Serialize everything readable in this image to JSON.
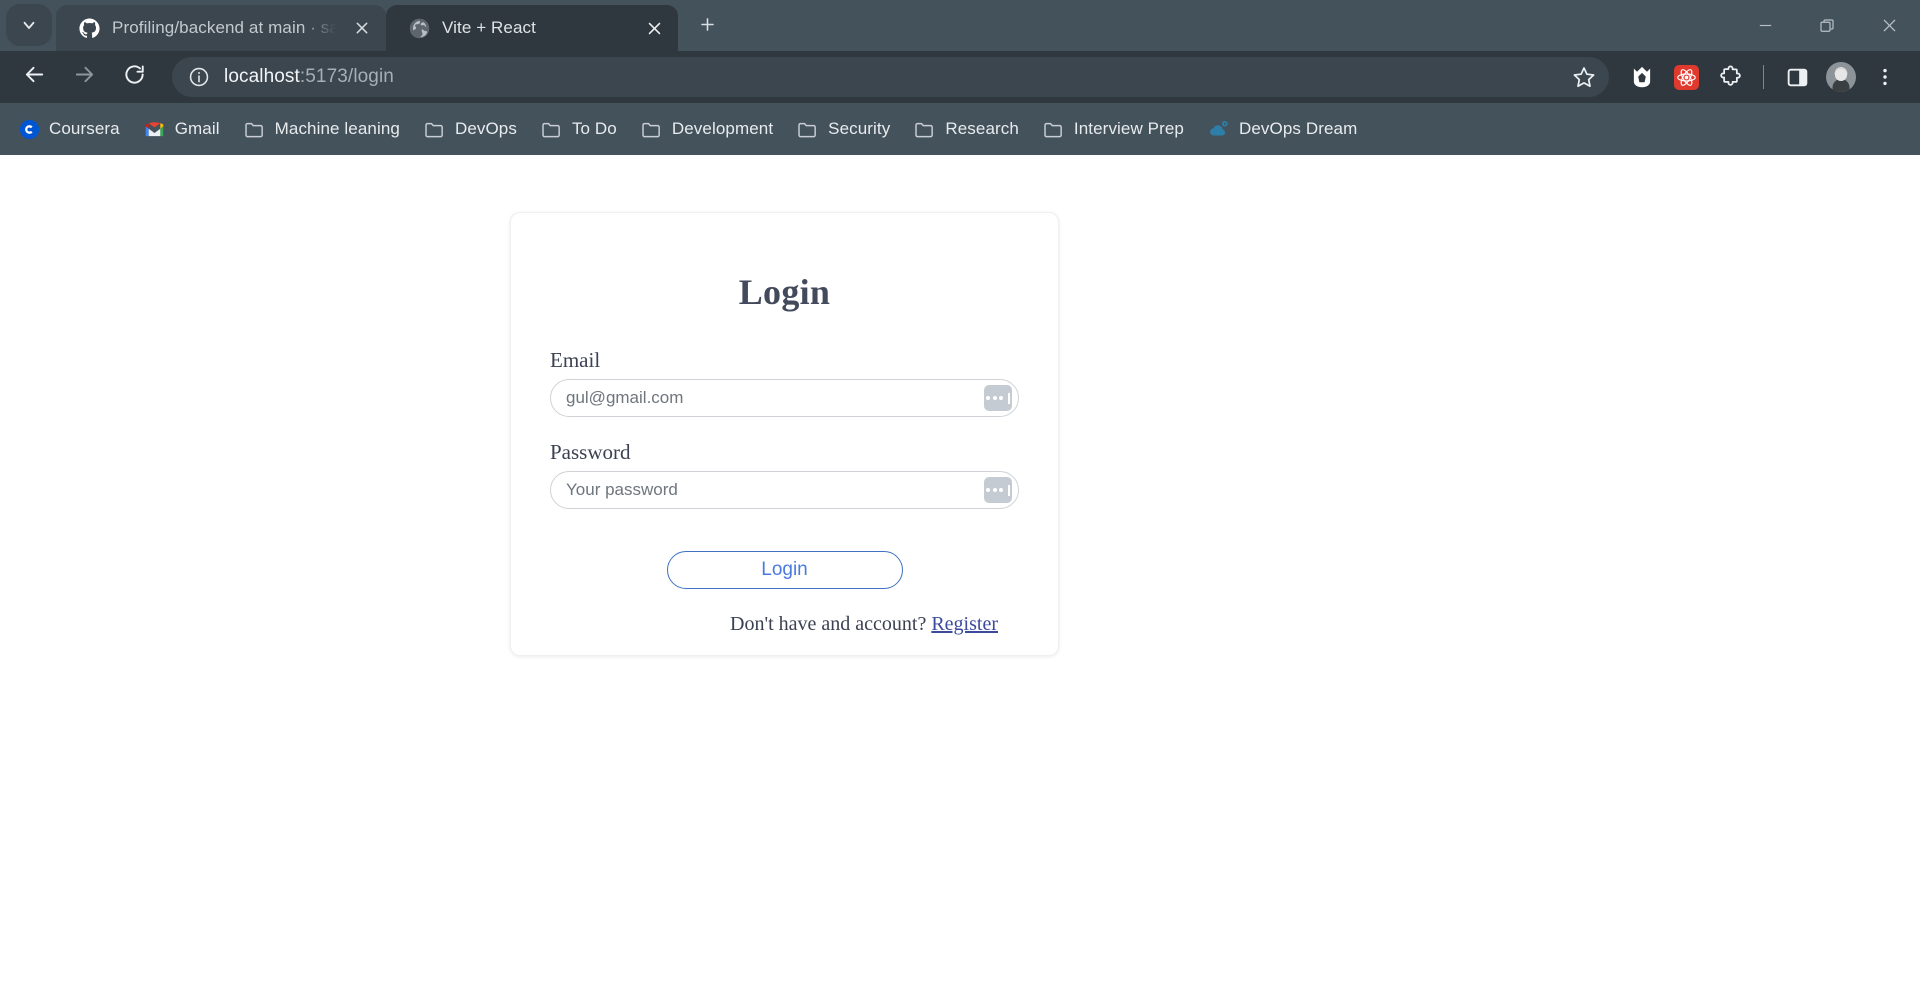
{
  "window": {
    "controls": [
      {
        "name": "minimize",
        "label": "Minimize"
      },
      {
        "name": "restore",
        "label": "Restore"
      },
      {
        "name": "close",
        "label": "Close"
      }
    ]
  },
  "tabstrip": {
    "tab_search_icon": "chevron-down-icon",
    "new_tab_label": "+",
    "tabs": [
      {
        "title": "Profiling/backend at main · sam",
        "favicon": "github-icon",
        "active": false
      },
      {
        "title": "Vite + React",
        "favicon": "globe-icon",
        "active": true
      }
    ]
  },
  "toolbar": {
    "back_icon": "arrow-left-icon",
    "forward_icon": "arrow-right-icon",
    "reload_icon": "reload-icon",
    "site_info_icon": "info-circle-icon",
    "url_host": "localhost",
    "url_rest": ":5173/login",
    "url_full": "localhost:5173/login",
    "bookmark_icon": "star-icon",
    "extensions": [
      {
        "name": "malwarebytes-extension",
        "label": "Malwarebytes",
        "color": "#ffffff"
      },
      {
        "name": "react-devtools-extension",
        "label": "React Developer Tools",
        "color": "#e03a2f"
      },
      {
        "name": "extensions-puzzle",
        "label": "Extensions",
        "color": "#ffffff"
      }
    ],
    "side_panel_icon": "side-panel-icon",
    "profile_label": "Profile",
    "menu_icon": "three-dot-menu-icon"
  },
  "bookmarks": [
    {
      "label": "Coursera",
      "icon": "coursera-icon"
    },
    {
      "label": "Gmail",
      "icon": "gmail-icon"
    },
    {
      "label": "Machine leaning",
      "icon": "folder-icon"
    },
    {
      "label": "DevOps",
      "icon": "folder-icon"
    },
    {
      "label": "To Do",
      "icon": "folder-icon"
    },
    {
      "label": "Development",
      "icon": "folder-icon"
    },
    {
      "label": "Security",
      "icon": "folder-icon"
    },
    {
      "label": "Research",
      "icon": "folder-icon"
    },
    {
      "label": "Interview Prep",
      "icon": "folder-icon"
    },
    {
      "label": "DevOps Dream",
      "icon": "cloud-gear-icon"
    }
  ],
  "page": {
    "title": "Login",
    "email": {
      "label": "Email",
      "value": "",
      "placeholder": "gul@gmail.com",
      "autofill_icon": "password-key-icon"
    },
    "password": {
      "label": "Password",
      "value": "",
      "placeholder": "Your password",
      "autofill_icon": "password-key-icon"
    },
    "submit_label": "Login",
    "register_prompt": "Don't have and account?",
    "register_link": "Register"
  },
  "colors": {
    "chrome_tabstrip": "#44525c",
    "chrome_toolbar": "#2f383f",
    "chrome_bookmarkbar": "#44525c",
    "accent_blue": "#4a7ae0",
    "link_blue": "#3b4a9c",
    "heading": "#434a5c",
    "page_background": "#ffffff"
  }
}
